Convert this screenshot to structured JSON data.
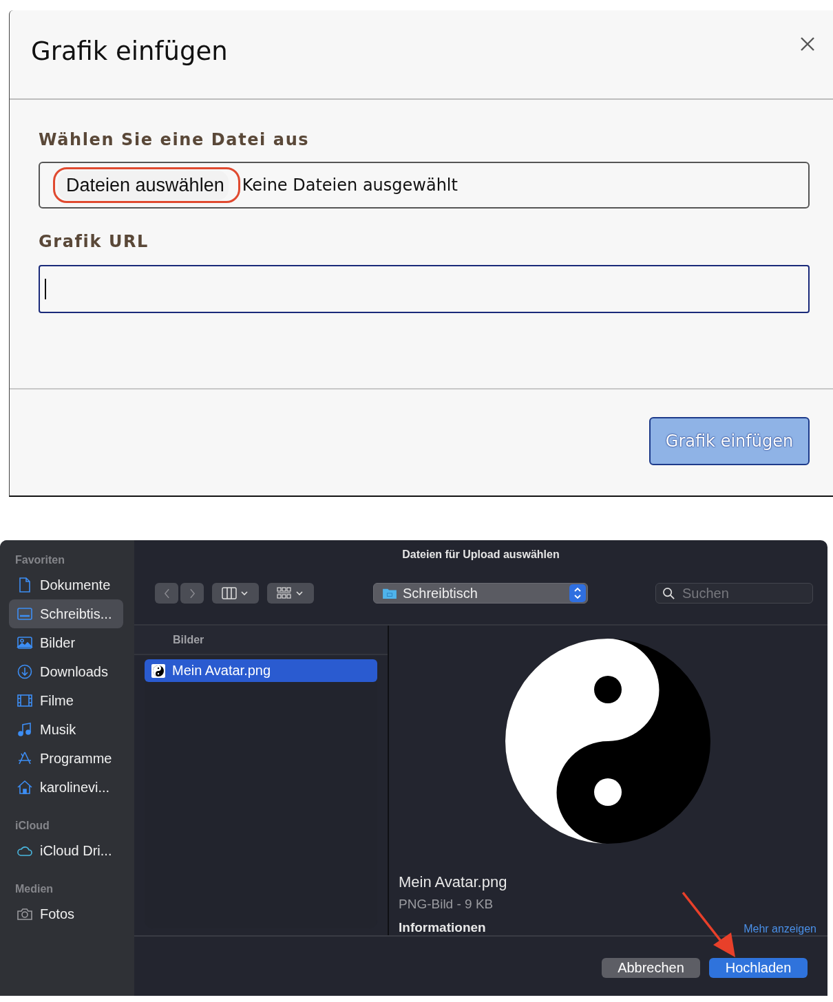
{
  "insert_dialog": {
    "title": "Grafik einfügen",
    "file_label": "Wählen Sie eine Datei aus",
    "file_button": "Dateien auswählen",
    "file_status": "Keine Dateien ausgewählt",
    "url_label": "Grafik URL",
    "url_focused": true,
    "submit": "Grafik einfügen"
  },
  "file_picker": {
    "title": "Dateien für Upload auswählen",
    "location": "Schreibtisch",
    "search": {
      "placeholder": "Suchen"
    },
    "sidebar": [
      {
        "heading": "Favoriten",
        "items": [
          {
            "label": "Dokumente",
            "selected": false
          },
          {
            "label": "Schreibtis...",
            "selected": true
          },
          {
            "label": "Bilder",
            "selected": false
          },
          {
            "label": "Downloads",
            "selected": false
          },
          {
            "label": "Filme",
            "selected": false
          },
          {
            "label": "Musik",
            "selected": false
          },
          {
            "label": "Programme",
            "selected": false
          },
          {
            "label": "karolinevi...",
            "selected": false
          }
        ]
      },
      {
        "heading": "iCloud",
        "items": [
          {
            "label": "iCloud Dri...",
            "selected": false
          }
        ]
      },
      {
        "heading": "Medien",
        "items": [
          {
            "label": "Fotos",
            "selected": false
          }
        ]
      }
    ],
    "column": {
      "header": "Bilder",
      "files": [
        {
          "name": "Mein Avatar.png",
          "selected": true
        }
      ]
    },
    "preview": {
      "name": "Mein Avatar.png",
      "meta": "PNG-Bild - 9 KB",
      "section": "Informationen",
      "more": "Mehr anzeigen"
    },
    "buttons": [
      {
        "label": "Abbrechen",
        "kind": "secondary"
      },
      {
        "label": "Hochladen",
        "kind": "primary"
      }
    ]
  }
}
